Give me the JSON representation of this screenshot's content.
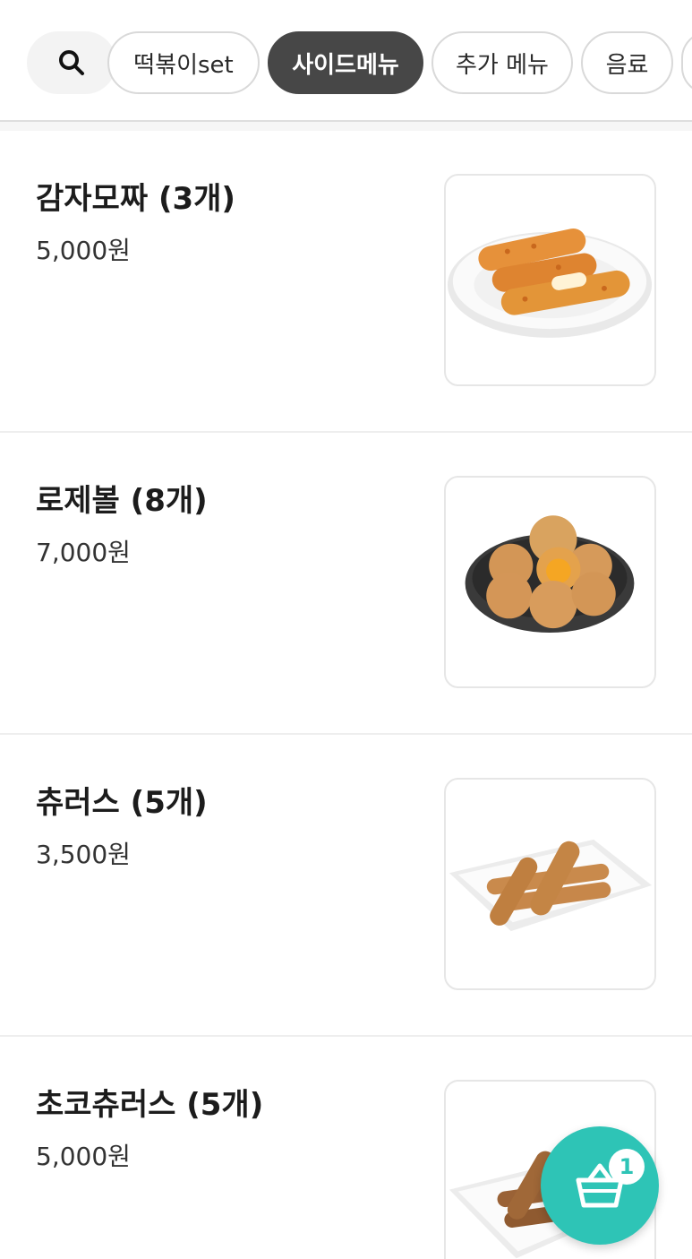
{
  "categories": [
    {
      "label": "떡볶이set",
      "active": false
    },
    {
      "label": "사이드메뉴",
      "active": true
    },
    {
      "label": "추가 메뉴",
      "active": false
    },
    {
      "label": "음료",
      "active": false
    },
    {
      "label": "",
      "active": false
    }
  ],
  "menu_items": [
    {
      "name": "감자모짜 (3개)",
      "price": "5,000원",
      "image": "potato-mozzarella-sticks"
    },
    {
      "name": "로제볼 (8개)",
      "price": "7,000원",
      "image": "rose-cheese-balls"
    },
    {
      "name": "츄러스 (5개)",
      "price": "3,500원",
      "image": "churros"
    },
    {
      "name": "초코츄러스 (5개)",
      "price": "5,000원",
      "image": "choco-churros"
    }
  ],
  "cart": {
    "count": "1",
    "icon": "shopping-basket-icon"
  },
  "colors": {
    "accent": "#2ec4b6",
    "active_chip": "#474747"
  }
}
